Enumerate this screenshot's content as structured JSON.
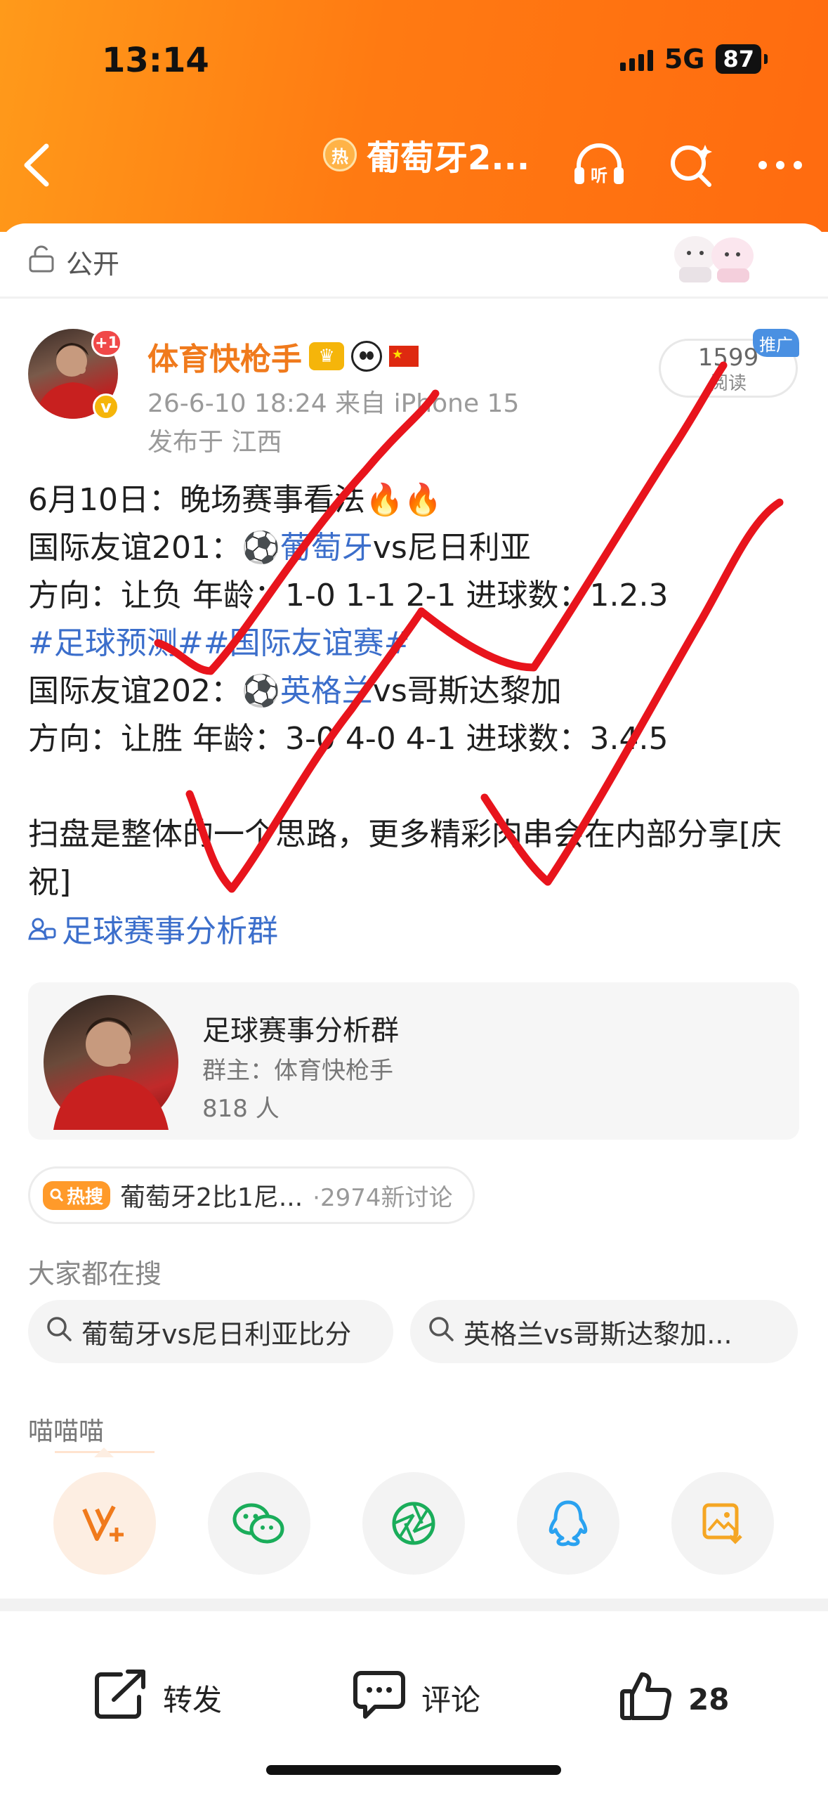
{
  "status_bar": {
    "time": "13:14",
    "network": "5G",
    "battery": "87"
  },
  "nav": {
    "hot_badge": "热",
    "title": "葡萄牙2..."
  },
  "visibility": {
    "label": "公开"
  },
  "author": {
    "name": "体育快枪手",
    "plus_badge": "+1",
    "time_device": "26-6-10 18:24  来自 iPhone 15",
    "location": "发布于 江西"
  },
  "read_stats": {
    "count": "1599",
    "label": "阅读",
    "promo_tag": "推广"
  },
  "post": {
    "line1": "6月10日：晚场赛事看法🔥🔥",
    "line2_prefix": "国际友谊201：",
    "line2_link": "⚽葡萄牙",
    "line2_suffix": "vs尼日利亚",
    "line3": "方向：让负  年龄：1-0  1-1  2-1  进球数：1.2.3",
    "hashtags": "#足球预测##国际友谊赛#",
    "line5_prefix": "国际友谊202：",
    "line5_link": "⚽英格兰",
    "line5_suffix": "vs哥斯达黎加",
    "line6": "方向：让胜  年龄：3-0  4-0  4-1    进球数：3.4.5",
    "line7": "扫盘是整体的一个思路，更多精彩肉串会在内部分享[庆祝]",
    "group_link": "足球赛事分析群"
  },
  "group_card": {
    "name": "足球赛事分析群",
    "owner": "群主：体育快枪手",
    "members": "818 人"
  },
  "hot_search": {
    "tag": "热搜",
    "text": "葡萄牙2比1尼...",
    "count": "·2974新讨论"
  },
  "related": {
    "title": "大家都在搜",
    "items": [
      "葡萄牙vs尼日利亚比分",
      "英格兰vs哥斯达黎加..."
    ]
  },
  "share": {
    "label": "喵喵喵",
    "targets": [
      "weibo-vplus-icon",
      "wechat-icon",
      "moments-icon",
      "qq-icon",
      "save-image-icon"
    ]
  },
  "bottom_bar": {
    "repost": "转发",
    "comment": "评论",
    "like_count": "28"
  },
  "colors": {
    "accent": "#ff7a12",
    "link": "#3b6ecb",
    "username": "#f07a1c",
    "check_mark": "#e8141c"
  }
}
